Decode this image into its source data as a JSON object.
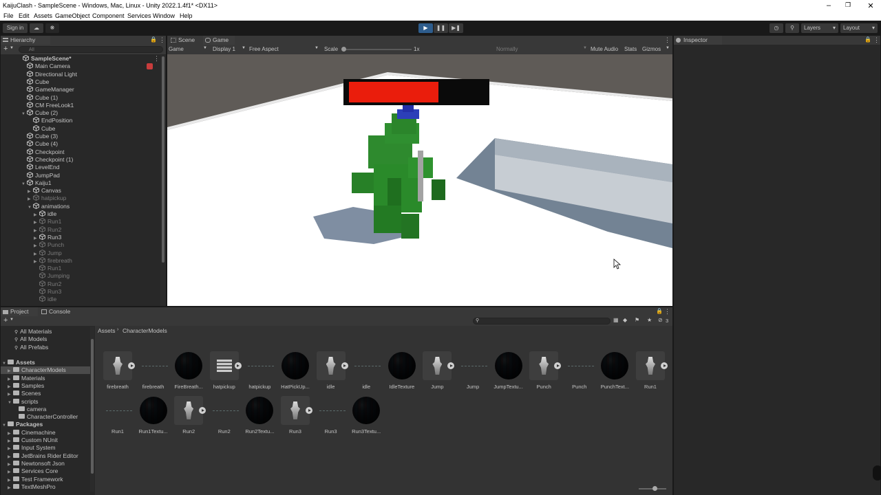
{
  "window": {
    "title": "KaijuClash - SampleScene - Windows, Mac, Linux - Unity 2022.1.4f1* <DX11>"
  },
  "menu": [
    "File",
    "Edit",
    "Assets",
    "GameObject",
    "Component",
    "Services",
    "Window",
    "Help"
  ],
  "toolbar": {
    "signin": "Sign in",
    "layers": "Layers",
    "layout": "Layout"
  },
  "hierarchy": {
    "tab": "Hierarchy",
    "search_placeholder": "All",
    "items": [
      {
        "label": "SampleScene*",
        "indent": 0,
        "bold": true,
        "dim": false
      },
      {
        "label": "Main Camera",
        "indent": 1,
        "dim": false
      },
      {
        "label": "Directional Light",
        "indent": 1,
        "dim": false
      },
      {
        "label": "Cube",
        "indent": 1,
        "dim": false
      },
      {
        "label": "GameManager",
        "indent": 1,
        "dim": false
      },
      {
        "label": "Cube (1)",
        "indent": 1,
        "dim": false
      },
      {
        "label": "CM FreeLook1",
        "indent": 1,
        "dim": false
      },
      {
        "label": "Cube (2)",
        "indent": 1,
        "dim": false,
        "open": true
      },
      {
        "label": "EndPosition",
        "indent": 2,
        "dim": false
      },
      {
        "label": "Cube",
        "indent": 2,
        "dim": false
      },
      {
        "label": "Cube (3)",
        "indent": 1,
        "dim": false
      },
      {
        "label": "Cube (4)",
        "indent": 1,
        "dim": false
      },
      {
        "label": "Checkpoint",
        "indent": 1,
        "dim": false
      },
      {
        "label": "Checkpoint (1)",
        "indent": 1,
        "dim": false
      },
      {
        "label": "LevelEnd",
        "indent": 1,
        "dim": false
      },
      {
        "label": "JumpPad",
        "indent": 1,
        "dim": false
      },
      {
        "label": "Kaiju1",
        "indent": 1,
        "dim": false,
        "open": true
      },
      {
        "label": "Canvas",
        "indent": 2,
        "dim": false,
        "closed": true
      },
      {
        "label": "hatpickup",
        "indent": 2,
        "dim": true,
        "closed": true
      },
      {
        "label": "animations",
        "indent": 2,
        "dim": false,
        "open": true
      },
      {
        "label": "idle",
        "indent": 3,
        "dim": false,
        "closed": true
      },
      {
        "label": "Run1",
        "indent": 3,
        "dim": true,
        "closed": true
      },
      {
        "label": "Run2",
        "indent": 3,
        "dim": true,
        "closed": true
      },
      {
        "label": "Run3",
        "indent": 3,
        "dim": false,
        "closed": true
      },
      {
        "label": "Punch",
        "indent": 3,
        "dim": true,
        "closed": true
      },
      {
        "label": "Jump",
        "indent": 3,
        "dim": true,
        "closed": true
      },
      {
        "label": "firebreath",
        "indent": 3,
        "dim": true,
        "closed": true
      },
      {
        "label": "Run1",
        "indent": 3,
        "dim": true
      },
      {
        "label": "Jumping",
        "indent": 3,
        "dim": true
      },
      {
        "label": "Run2",
        "indent": 3,
        "dim": true
      },
      {
        "label": "Run3",
        "indent": 3,
        "dim": true
      },
      {
        "label": "idle",
        "indent": 3,
        "dim": true
      }
    ]
  },
  "game": {
    "tabs": [
      "Scene",
      "Game"
    ],
    "display_mode": "Game",
    "display": "Display 1",
    "aspect": "Free Aspect",
    "scale_label": "Scale",
    "scale_value": "1x",
    "quality": "Normally",
    "mute": "Mute Audio",
    "stats": "Stats",
    "gizmos": "Gizmos",
    "health_fraction": 0.65
  },
  "inspector": {
    "tab": "Inspector"
  },
  "project": {
    "tabs": [
      "Project",
      "Console"
    ],
    "favorites": [
      "All Materials",
      "All Models",
      "All Prefabs"
    ],
    "tree": [
      {
        "label": "Assets",
        "indent": 0,
        "bold": true
      },
      {
        "label": "CharacterModels",
        "indent": 1,
        "selected": true
      },
      {
        "label": "Materials",
        "indent": 1
      },
      {
        "label": "Samples",
        "indent": 1
      },
      {
        "label": "Scenes",
        "indent": 1
      },
      {
        "label": "scripts",
        "indent": 1
      },
      {
        "label": "camera",
        "indent": 2
      },
      {
        "label": "CharacterController",
        "indent": 2
      },
      {
        "label": "Packages",
        "indent": 0,
        "bold": true
      },
      {
        "label": "Cinemachine",
        "indent": 1
      },
      {
        "label": "Custom NUnit",
        "indent": 1
      },
      {
        "label": "Input System",
        "indent": 1
      },
      {
        "label": "JetBrains Rider Editor",
        "indent": 1
      },
      {
        "label": "Newtonsoft Json",
        "indent": 1
      },
      {
        "label": "Services Core",
        "indent": 1
      },
      {
        "label": "Test Framework",
        "indent": 1
      },
      {
        "label": "TextMeshPro",
        "indent": 1
      }
    ],
    "breadcrumb": [
      "Assets",
      "CharacterModels"
    ],
    "hidden_count": "3",
    "assets_row1": [
      {
        "label": "firebreath",
        "kind": "model"
      },
      {
        "label": "firebreath",
        "kind": "anim"
      },
      {
        "label": "FireBreath...",
        "kind": "material"
      },
      {
        "label": "hatpickup",
        "kind": "hatmodel"
      },
      {
        "label": "hatpickup",
        "kind": "anim"
      },
      {
        "label": "HatPickUp...",
        "kind": "material"
      },
      {
        "label": "idle",
        "kind": "model"
      },
      {
        "label": "idle",
        "kind": "anim"
      },
      {
        "label": "IdleTexture",
        "kind": "material"
      },
      {
        "label": "Jump",
        "kind": "model"
      },
      {
        "label": "Jump",
        "kind": "anim"
      },
      {
        "label": "JumpTextu...",
        "kind": "material"
      },
      {
        "label": "Punch",
        "kind": "model"
      },
      {
        "label": "Punch",
        "kind": "anim"
      },
      {
        "label": "PunchText...",
        "kind": "material"
      },
      {
        "label": "Run1",
        "kind": "model"
      }
    ],
    "assets_row2": [
      {
        "label": "Run1",
        "kind": "anim"
      },
      {
        "label": "Run1Textu...",
        "kind": "material"
      },
      {
        "label": "Run2",
        "kind": "model"
      },
      {
        "label": "Run2",
        "kind": "anim"
      },
      {
        "label": "Run2Textu...",
        "kind": "material"
      },
      {
        "label": "Run3",
        "kind": "model"
      },
      {
        "label": "Run3",
        "kind": "anim"
      },
      {
        "label": "Run3Textu...",
        "kind": "material"
      }
    ]
  }
}
